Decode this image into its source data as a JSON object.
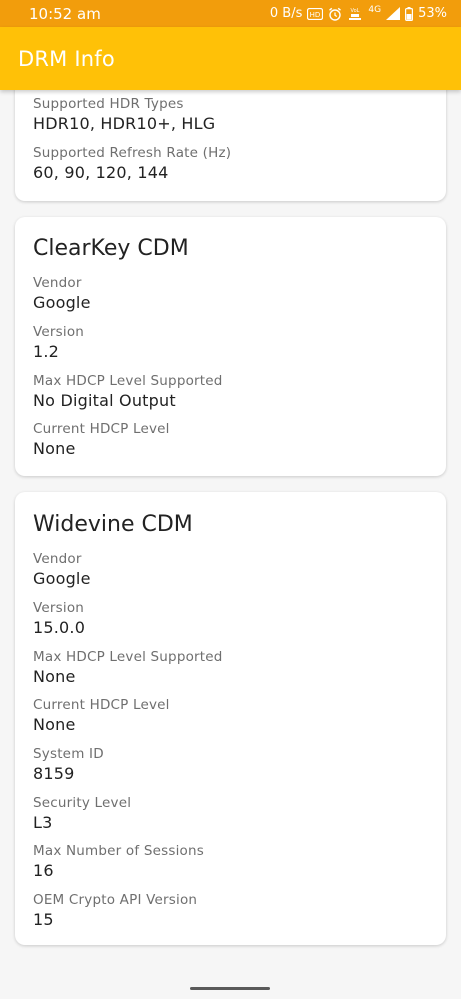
{
  "status_bar": {
    "time": "10:52 am",
    "net_speed": "0 B/s",
    "network_type": "4G",
    "battery": "53%",
    "icons": [
      "hd-voice-icon",
      "alarm-icon",
      "data-icon",
      "signal-icon",
      "battery-icon"
    ]
  },
  "app_bar": {
    "title": "DRM Info"
  },
  "sections": [
    {
      "title": "",
      "fields": [
        {
          "label": "Supported HDR Types",
          "value": "HDR10, HDR10+, HLG"
        },
        {
          "label": "Supported Refresh Rate (Hz)",
          "value": "60, 90, 120, 144"
        }
      ]
    },
    {
      "title": "ClearKey CDM",
      "fields": [
        {
          "label": "Vendor",
          "value": "Google"
        },
        {
          "label": "Version",
          "value": "1.2"
        },
        {
          "label": "Max HDCP Level Supported",
          "value": "No Digital Output"
        },
        {
          "label": "Current HDCP Level",
          "value": "None"
        }
      ]
    },
    {
      "title": "Widevine CDM",
      "fields": [
        {
          "label": "Vendor",
          "value": "Google"
        },
        {
          "label": "Version",
          "value": "15.0.0"
        },
        {
          "label": "Max HDCP Level Supported",
          "value": "None"
        },
        {
          "label": "Current HDCP Level",
          "value": "None"
        },
        {
          "label": "System ID",
          "value": "8159"
        },
        {
          "label": "Security Level",
          "value": "L3"
        },
        {
          "label": "Max Number of Sessions",
          "value": "16"
        },
        {
          "label": "OEM Crypto API Version",
          "value": "15"
        }
      ]
    }
  ]
}
